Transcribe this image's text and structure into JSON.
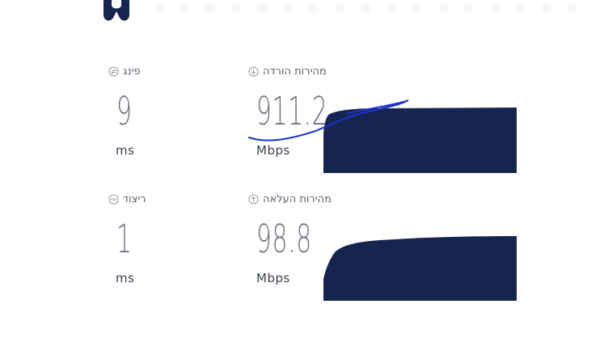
{
  "colors": {
    "redaction": "#15254f",
    "scribble": "#1a33c8",
    "label": "#5b6270",
    "value": "#707680",
    "unit": "#3b4150"
  },
  "metrics": {
    "ping": {
      "label": "פינג",
      "icon": "ping-icon",
      "value": "9",
      "unit": "ms"
    },
    "download": {
      "label": "מהירות הורדה",
      "icon": "download-arrow-icon",
      "value": "911.2",
      "unit": "Mbps"
    },
    "jitter": {
      "label": "ריצוד",
      "icon": "jitter-icon",
      "value": "1",
      "unit": "ms"
    },
    "upload": {
      "label": "מהירות העלאה",
      "icon": "upload-arrow-icon",
      "value": "98.8",
      "unit": "Mbps"
    }
  }
}
